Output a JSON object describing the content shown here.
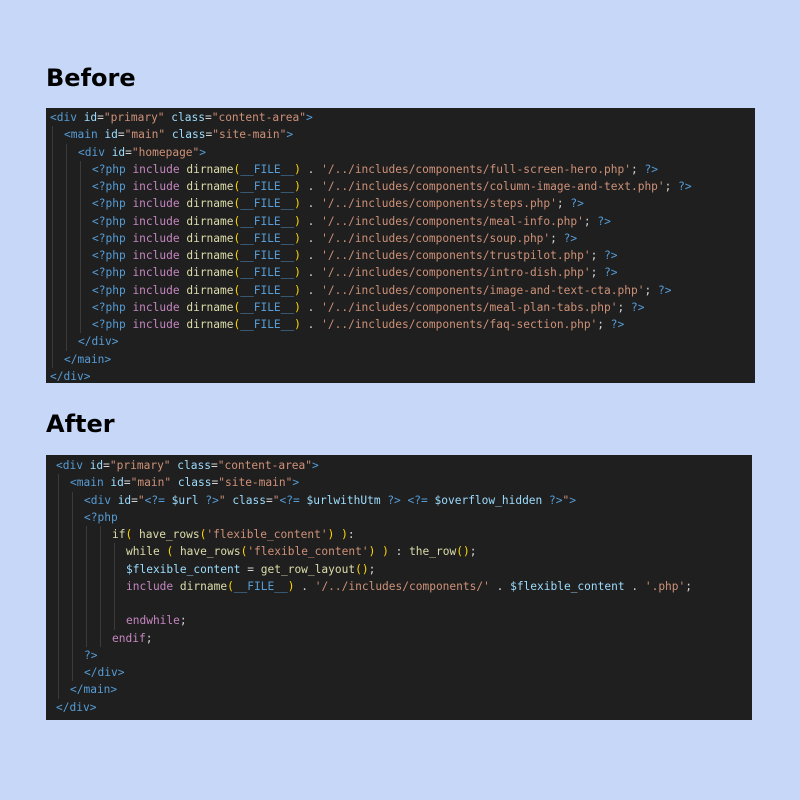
{
  "headings": {
    "before": "Before",
    "after": "After"
  },
  "before": {
    "open_lines": [
      "<div id=\"primary\" class=\"content-area\">",
      "<main id=\"main\" class=\"site-main\">",
      "<div id=\"homepage\">"
    ],
    "include_prefix": "<?php include dirname(__FILE__) . '",
    "include_suffix": "'; ?>",
    "include_paths": [
      "/../includes/components/full-screen-hero.php",
      "/../includes/components/column-image-and-text.php",
      "/../includes/components/steps.php",
      "/../includes/components/meal-info.php",
      "/../includes/components/soup.php",
      "/../includes/components/trustpilot.php",
      "/../includes/components/intro-dish.php",
      "/../includes/components/image-and-text-cta.php",
      "/../includes/components/meal-plan-tabs.php",
      "/../includes/components/faq-section.php"
    ],
    "close_lines": [
      "</div>",
      "</main>",
      "</div>"
    ]
  },
  "after": {
    "lines": [
      "<div id=\"primary\" class=\"content-area\">",
      "<main id=\"main\" class=\"site-main\">",
      "<div id=\"<?= $url ?>\" class=\"<?= $urlwithUtm ?> <?= $overflow_hidden ?>\">",
      "<?php",
      "if( have_rows('flexible_content') ):",
      "while ( have_rows('flexible_content') ) : the_row();",
      "$flexible_content = get_row_layout();",
      "include dirname(__FILE__) . '/../includes/components/' . $flexible_content . '.php';",
      "",
      "endwhile;",
      "endif;",
      "?>",
      "</div>",
      "</main>",
      "</div>"
    ]
  },
  "colors": {
    "background": "#c6d7f8",
    "editor_background": "#1f1f1f",
    "tag": "#569cd6",
    "attribute": "#9cdcfe",
    "string": "#ce9178",
    "function": "#dcdcaa",
    "keyword": "#c586c0"
  }
}
